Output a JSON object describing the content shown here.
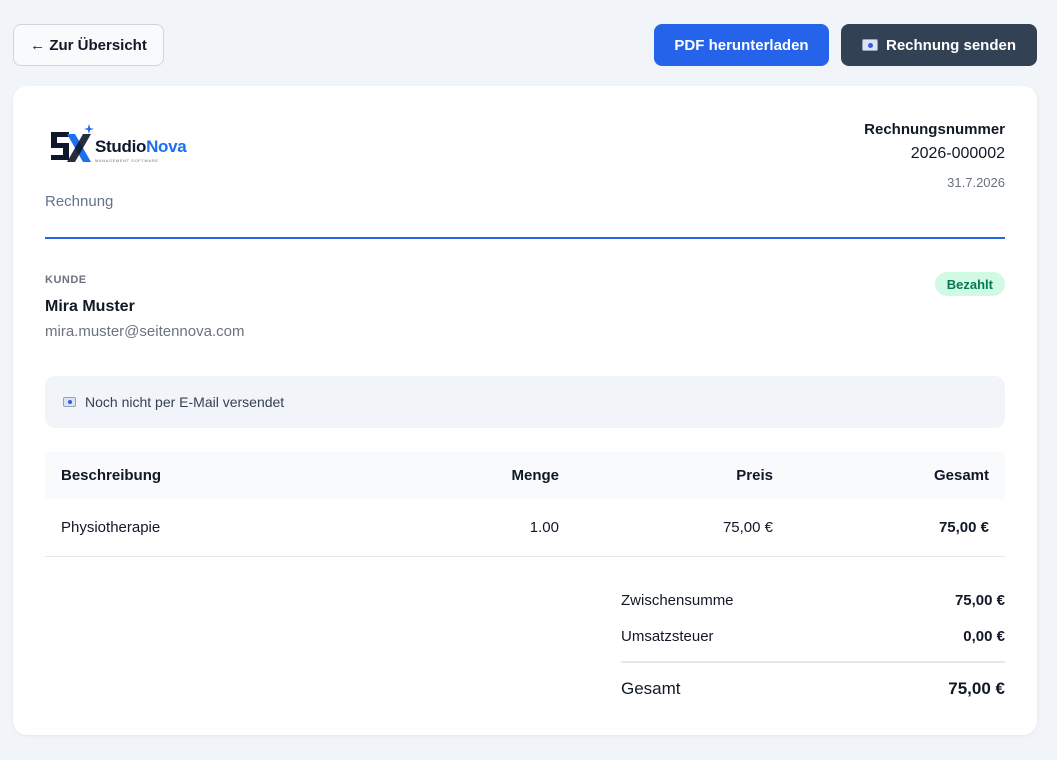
{
  "toolbar": {
    "back_label": "← Zur Übersicht",
    "pdf_label": "PDF herunterladen",
    "send_label": "Rechnung senden"
  },
  "invoice": {
    "brand_name_part1": "Studio",
    "brand_name_part2": "Nova",
    "brand_tagline": "MANAGEMENT SOFTWARE",
    "doc_type": "Rechnung",
    "number_label": "Rechnungsnummer",
    "number": "2026-000002",
    "date": "31.7.2026"
  },
  "customer": {
    "section_label": "KUNDE",
    "name": "Mira Muster",
    "email": "mira.muster@seitennova.com",
    "status": "Bezahlt"
  },
  "notice": {
    "text": "Noch nicht per E-Mail versendet"
  },
  "table": {
    "headers": {
      "description": "Beschreibung",
      "quantity": "Menge",
      "price": "Preis",
      "total": "Gesamt"
    },
    "rows": [
      {
        "description": "Physiotherapie",
        "quantity": "1.00",
        "price": "75,00 €",
        "total": "75,00 €"
      }
    ]
  },
  "totals": {
    "subtotal_label": "Zwischensumme",
    "subtotal": "75,00 €",
    "tax_label": "Umsatzsteuer",
    "tax": "0,00 €",
    "total_label": "Gesamt",
    "total": "75,00 €"
  },
  "colors": {
    "accent": "#2563eb",
    "dark_button": "#334155",
    "paid_bg": "#d1fae5",
    "paid_text": "#047857"
  }
}
